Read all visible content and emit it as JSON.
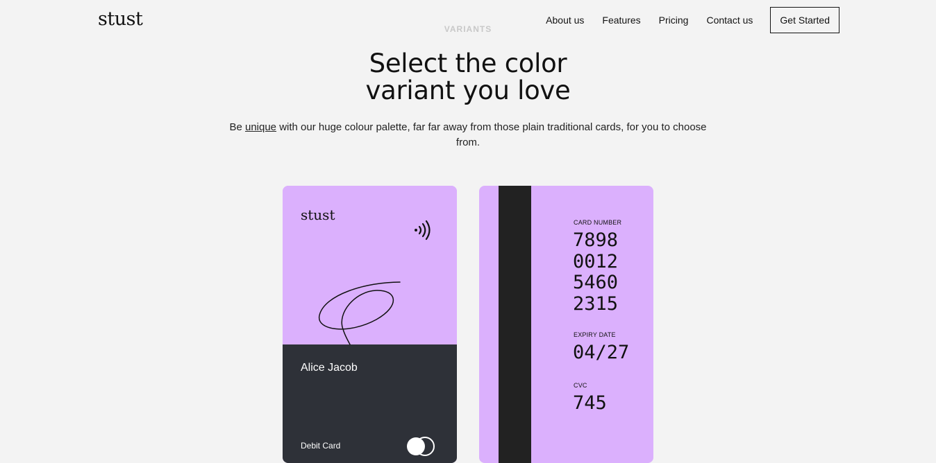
{
  "brand": {
    "name": "stust"
  },
  "nav": {
    "items": [
      "About us",
      "Features",
      "Pricing",
      "Contact us"
    ],
    "cta": "Get Started"
  },
  "hero": {
    "eyebrow": "VARIANTS",
    "title_line1": "Select the color",
    "title_line2": "variant you love",
    "subtitle_pre": "Be ",
    "subtitle_emph": "unique",
    "subtitle_post": " with our huge colour palette, far far away from those plain traditional cards, for you to choose from."
  },
  "card_front": {
    "logo": "stust",
    "holder": "Alice Jacob",
    "type": "Debit Card",
    "icons": {
      "contactless": "contactless-icon",
      "network": "mastercard-logo-icon",
      "signature": "signature-icon"
    }
  },
  "card_back": {
    "number_label": "CARD NUMBER",
    "number_groups": [
      "7898",
      "0012",
      "5460",
      "2315"
    ],
    "expiry_label": "EXPIRY DATE",
    "expiry": "04/27",
    "cvc_label": "CVC",
    "cvc": "745"
  },
  "colors": {
    "background": "#f3f3f3",
    "card_lilac": "#dbb0fd",
    "card_dark": "#2e3138",
    "stripe": "#222222"
  }
}
